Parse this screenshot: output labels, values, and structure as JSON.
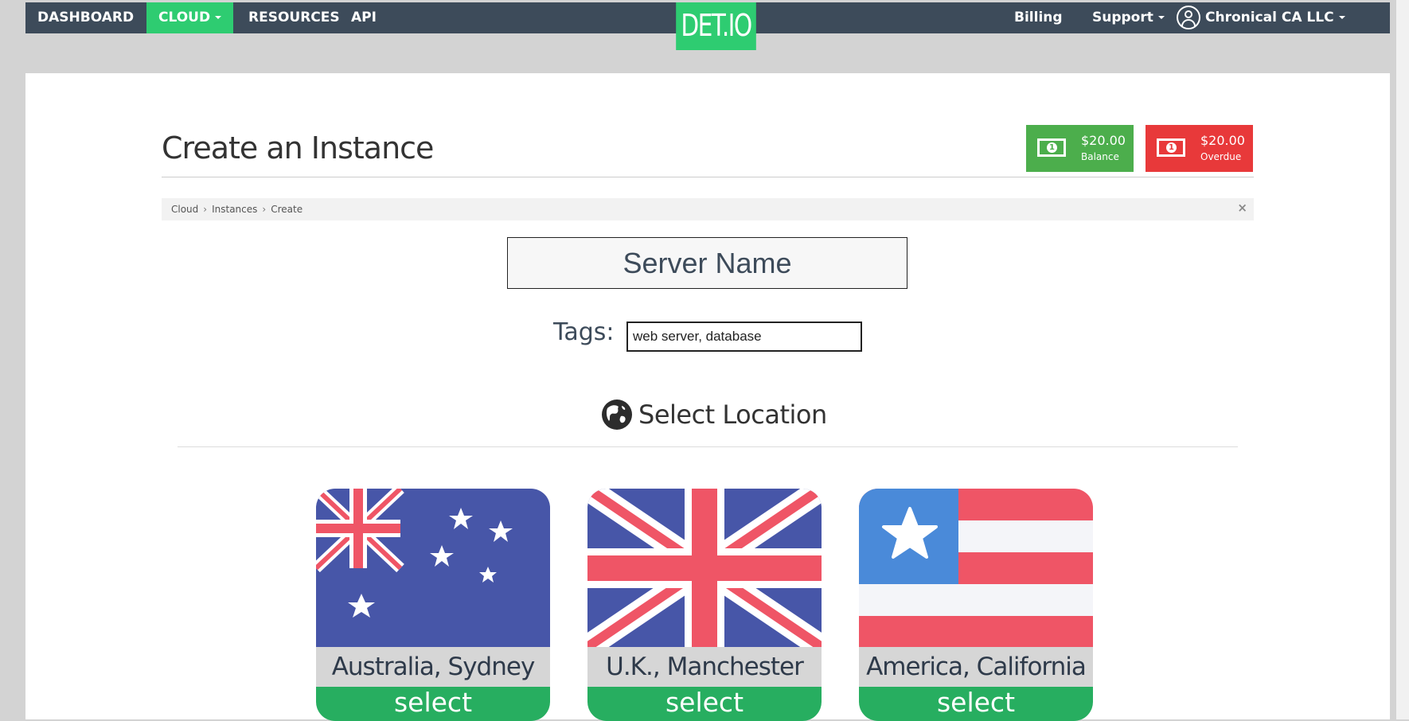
{
  "nav": {
    "left": [
      "DASHBOARD",
      "CLOUD",
      "RESOURCES",
      "API"
    ],
    "active": "CLOUD",
    "logo": "DET.IO",
    "right": {
      "billing": "Billing",
      "support": "Support",
      "account": "Chronical CA LLC"
    }
  },
  "page": {
    "title": "Create an Instance"
  },
  "money": {
    "balance": {
      "amount": "$20.00",
      "label": "Balance"
    },
    "overdue": {
      "amount": "$20.00",
      "label": "Overdue"
    }
  },
  "breadcrumb": [
    "Cloud",
    "Instances",
    "Create"
  ],
  "form": {
    "server_name_placeholder": "Server Name",
    "tags_label": "Tags:",
    "tags_value": "web server, database"
  },
  "location": {
    "heading": "Select Location",
    "cards": [
      {
        "city": "Australia, Sydney",
        "select": "select",
        "flag": "australia-flag"
      },
      {
        "city": "U.K., Manchester",
        "select": "select",
        "flag": "uk-flag"
      },
      {
        "city": "America, California",
        "select": "select",
        "flag": "usa-flag"
      }
    ]
  },
  "colors": {
    "nav_bg": "#3d4b5a",
    "accent_green": "#2ecc71",
    "balance_green": "#4cae4c",
    "overdue_red": "#e8393a",
    "flag_blue": "#4756a8",
    "flag_red": "#ef5566",
    "select_green": "#27ae60"
  }
}
